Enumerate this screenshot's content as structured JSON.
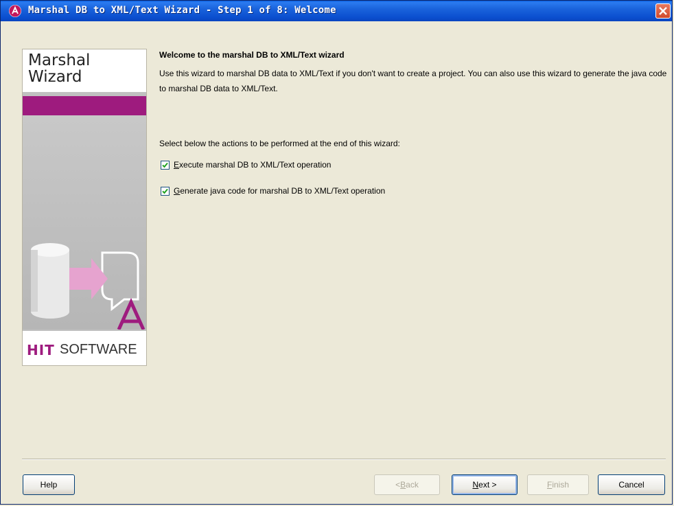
{
  "window": {
    "title": "Marshal DB to XML/Text Wizard - Step 1 of 8: Welcome"
  },
  "side_panel": {
    "title": "Marshal\nWizard",
    "logo_hit": "HIT",
    "logo_software": "SOFTWARE"
  },
  "content": {
    "heading": "Welcome to the marshal DB to XML/Text wizard",
    "description": "Use this wizard to marshal DB data to XML/Text if you don't want to create a project. You can also use this wizard to generate the java code to marshal DB data to XML/Text.",
    "actions_prompt": "Select below the actions to be performed at the end of this wizard:",
    "options": [
      {
        "mnemonic": "E",
        "rest": "xecute marshal DB to XML/Text operation",
        "checked": true
      },
      {
        "mnemonic": "G",
        "rest": "enerate java code for marshal DB to XML/Text operation",
        "checked": true
      }
    ]
  },
  "buttons": {
    "help": "Help",
    "back_prefix": "< ",
    "back_mnemonic": "B",
    "back_rest": "ack",
    "next_mnemonic": "N",
    "next_rest": "ext >",
    "finish_mnemonic": "F",
    "finish_rest": "inish",
    "cancel": "Cancel"
  },
  "colors": {
    "accent": "#9e1b7e",
    "titlebar": "#0b4fcf",
    "dialog_bg": "#ece9d8"
  }
}
